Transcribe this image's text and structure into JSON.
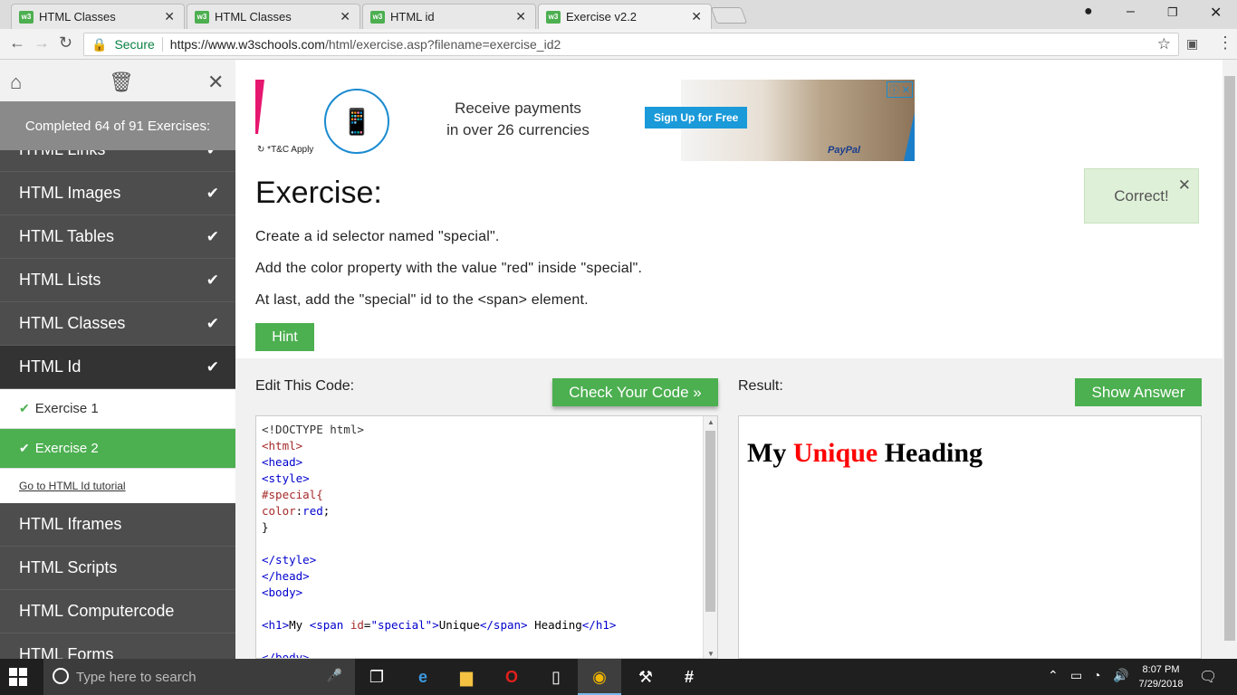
{
  "browser": {
    "tabs": [
      {
        "label": "HTML Classes",
        "favicon": "w3"
      },
      {
        "label": "HTML Classes",
        "favicon": "w3"
      },
      {
        "label": "HTML id",
        "favicon": "w3"
      },
      {
        "label": "Exercise v2.2",
        "favicon": "w3"
      }
    ],
    "secure_label": "Secure",
    "url_domain": "https://www.w3schools.com",
    "url_path": "/html/exercise.asp?filename=exercise_id2"
  },
  "sidebar": {
    "completed": "Completed 64 of 91 Exercises:",
    "items": [
      {
        "label": "HTML Links"
      },
      {
        "label": "HTML Images"
      },
      {
        "label": "HTML Tables"
      },
      {
        "label": "HTML Lists"
      },
      {
        "label": "HTML Classes"
      },
      {
        "label": "HTML Id"
      }
    ],
    "sub_items": [
      {
        "label": "Exercise 1"
      },
      {
        "label": "Exercise 2"
      }
    ],
    "tutorial_link": "Go to HTML Id tutorial",
    "after_items": [
      {
        "label": "HTML Iframes"
      },
      {
        "label": "HTML Scripts"
      },
      {
        "label": "HTML Computercode"
      },
      {
        "label": "HTML Forms"
      }
    ]
  },
  "ad": {
    "tc": "*T&C Apply",
    "line1": "Receive payments",
    "line2": "in over 26 currencies",
    "signup": "Sign Up for Free",
    "brand": "PayPal"
  },
  "exercise": {
    "title": "Exercise:",
    "instructions": [
      "Create a id selector named \"special\".",
      "Add the color property with the value \"red\" inside \"special\".",
      "At last, add the \"special\" id to the <span> element."
    ],
    "hint": "Hint",
    "correct": "Correct!"
  },
  "workspace": {
    "edit_label": "Edit This Code:",
    "check_button": "Check Your Code »",
    "result_label": "Result:",
    "answer_button": "Show Answer",
    "code_lines": [
      "<!DOCTYPE html>",
      "<html>",
      "<head>",
      "<style>",
      "#special{",
      "color:red;",
      "}",
      "",
      "</style>",
      "</head>",
      "<body>",
      "",
      "<h1>My <span id=\"special\">Unique</span> Heading</h1>",
      "",
      "</body>"
    ],
    "result": {
      "before": "My ",
      "highlight": "Unique",
      "after": " Heading",
      "highlight_color": "#ff0000"
    }
  },
  "taskbar": {
    "search_placeholder": "Type here to search",
    "time": "8:07 PM",
    "date": "7/29/2018"
  },
  "colors": {
    "accent_green": "#4caf50",
    "sidebar_bg": "#4d4d4d",
    "correct_bg": "#dff0d8"
  }
}
